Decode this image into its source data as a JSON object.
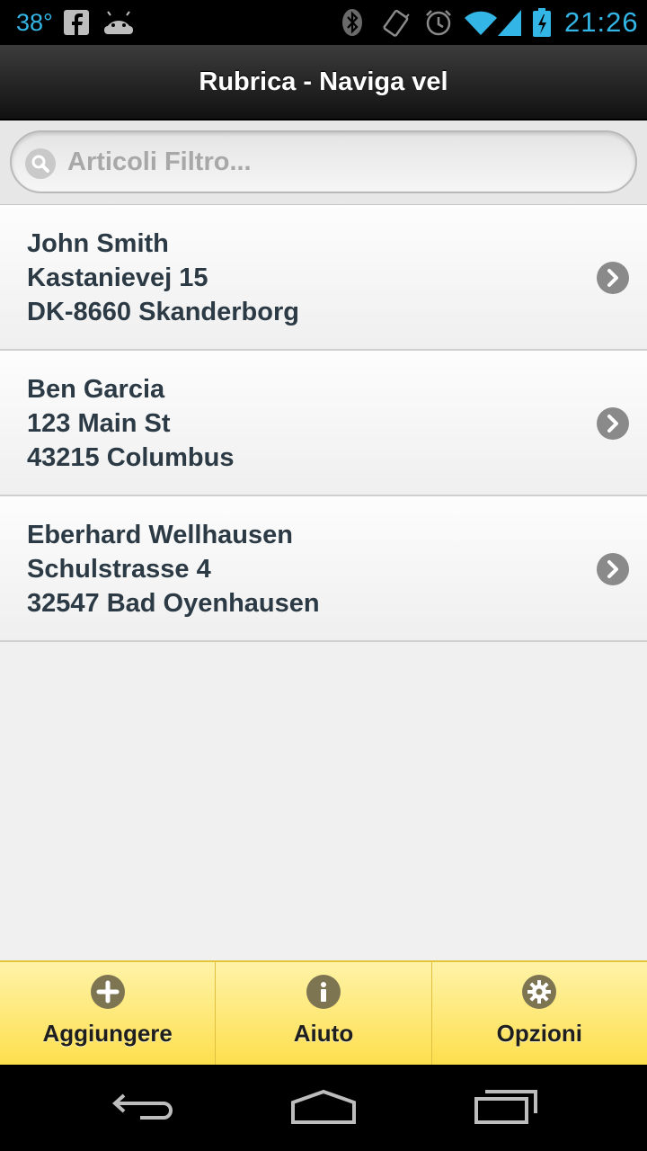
{
  "status_bar": {
    "temperature": "38°",
    "time": "21:26",
    "accent_color": "#33b5e5"
  },
  "header": {
    "title": "Rubrica - Naviga vel"
  },
  "search": {
    "placeholder": "Articoli Filtro..."
  },
  "contacts": [
    {
      "name": "John Smith",
      "street": "Kastanievej 15",
      "city": "DK-8660 Skanderborg"
    },
    {
      "name": "Ben Garcia",
      "street": "123 Main St",
      "city": "43215 Columbus"
    },
    {
      "name": "Eberhard Wellhausen",
      "street": "Schulstrasse 4",
      "city": "32547 Bad Oyenhausen"
    }
  ],
  "footer": {
    "tabs": [
      {
        "label": "Aggiungere",
        "icon": "plus-icon"
      },
      {
        "label": "Aiuto",
        "icon": "info-icon"
      },
      {
        "label": "Opzioni",
        "icon": "gear-icon"
      }
    ],
    "color": "#fde46a"
  },
  "system_nav": {
    "buttons": [
      "back-icon",
      "home-icon",
      "recent-apps-icon"
    ]
  }
}
